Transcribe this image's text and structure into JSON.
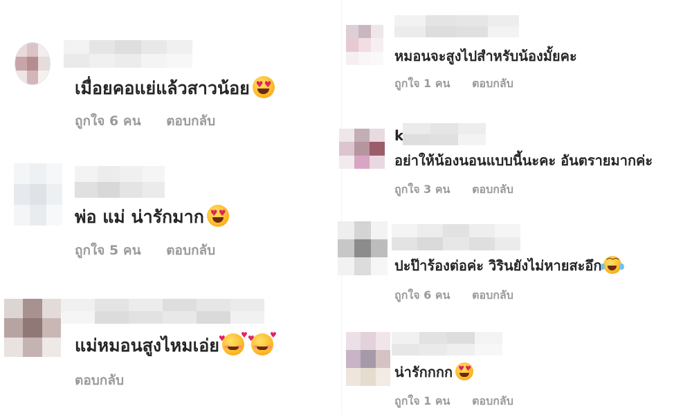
{
  "left_column": [
    {
      "text": "เมื่อยคอแย่แล้วสาวน้อย",
      "emoji": "heart-eyes-icon",
      "likes": "ถูกใจ 6 คน",
      "reply": "ตอบกลับ"
    },
    {
      "text": "พ่อ แม่ น่ารักมาก",
      "emoji": "heart-eyes-icon",
      "likes": "ถูกใจ 5 คน",
      "reply": "ตอบกลับ"
    },
    {
      "text": "แม่หมอนสูงไหมเอ่ย",
      "emoji": "smiling-face-with-hearts-icon",
      "likes": "",
      "reply": "ตอบกลับ"
    }
  ],
  "right_column": [
    {
      "text": "หมอนจะสูงไปสำหรับน้องมั้ยคะ",
      "emoji": "",
      "likes": "ถูกใจ 1 คน",
      "reply": "ตอบกลับ"
    },
    {
      "initial": "k",
      "text": "อย่าให้น้องนอนแบบนี้นะคะ อันตรายมากค่ะ",
      "emoji": "",
      "likes": "ถูกใจ 3 คน",
      "reply": "ตอบกลับ"
    },
    {
      "text": "ปะป๊าร้องต่อค่ะ วิรินยังไม่หายสะอึก",
      "emoji": "tears-of-joy-icon",
      "likes": "ถูกใจ 6 คน",
      "reply": "ตอบกลับ"
    },
    {
      "text": "น่ารักกกก",
      "emoji": "heart-eyes-icon",
      "likes": "ถูกใจ 1 คน",
      "reply": "ตอบกลับ"
    }
  ],
  "colors": {
    "text": "#262626",
    "meta": "#9a9a9a",
    "heart": "#e0245e",
    "emoji_face": "#fbb31f"
  }
}
